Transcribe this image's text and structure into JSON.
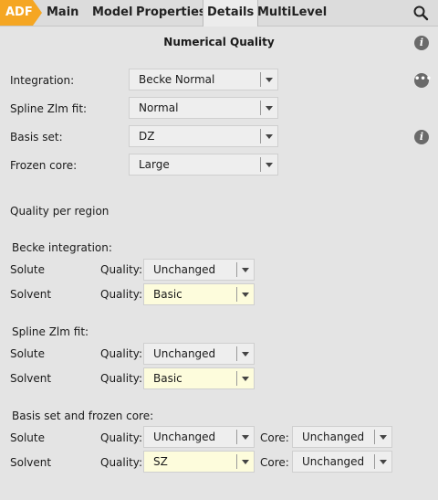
{
  "tabs": [
    {
      "label": "ADF"
    },
    {
      "label": "Main"
    },
    {
      "label": "Model"
    },
    {
      "label": "Properties"
    },
    {
      "label": "Details"
    },
    {
      "label": "MultiLevel"
    }
  ],
  "active_tab": "Details",
  "accent_color": "#f5a623",
  "title": "Numerical Quality",
  "main": {
    "integration": {
      "label": "Integration:",
      "value": "Becke Normal"
    },
    "spline": {
      "label": "Spline Zlm fit:",
      "value": "Normal"
    },
    "basis": {
      "label": "Basis set:",
      "value": "DZ"
    },
    "frozen": {
      "label": "Frozen core:",
      "value": "Large"
    }
  },
  "quality_per_region": "Quality per region",
  "becke": {
    "heading": "Becke integration:",
    "solute": {
      "label": "Solute",
      "quality_label": "Quality:",
      "value": "Unchanged"
    },
    "solvent": {
      "label": "Solvent",
      "quality_label": "Quality:",
      "value": "Basic"
    }
  },
  "spline_section": {
    "heading": "Spline Zlm fit:",
    "solute": {
      "label": "Solute",
      "quality_label": "Quality:",
      "value": "Unchanged"
    },
    "solvent": {
      "label": "Solvent",
      "quality_label": "Quality:",
      "value": "Basic"
    }
  },
  "basis_section": {
    "heading": "Basis set and frozen core:",
    "solute": {
      "label": "Solute",
      "quality_label": "Quality:",
      "value": "Unchanged",
      "core_label": "Core:",
      "core_value": "Unchanged"
    },
    "solvent": {
      "label": "Solvent",
      "quality_label": "Quality:",
      "value": "SZ",
      "core_label": "Core:",
      "core_value": "Unchanged"
    }
  },
  "icons": {
    "info": "i",
    "more": "•••",
    "search": "search-icon"
  }
}
